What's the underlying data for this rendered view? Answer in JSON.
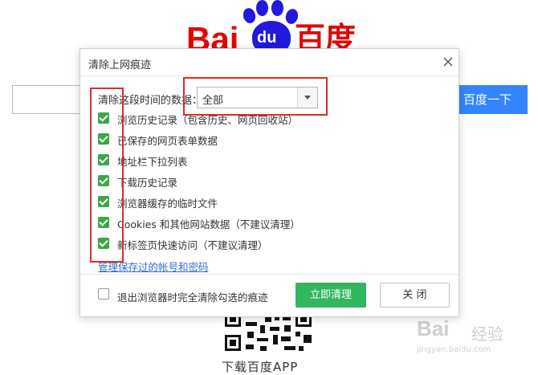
{
  "background": {
    "logo": {
      "word": "Bai",
      "du": "du",
      "cn": "百度"
    },
    "search_button": "百度一下",
    "qr_caption": "下载百度APP",
    "watermark": {
      "logo": "Bai",
      "jingyan": "经验",
      "url": "jingyan.baidu.com"
    }
  },
  "dialog": {
    "title": "清除上网痕迹",
    "range_label": "清除这段时间的数据：",
    "range_value": "全部",
    "options": [
      {
        "label": "浏览历史记录（包含历史、网页回收站）",
        "checked": true
      },
      {
        "label": "已保存的网页表单数据",
        "checked": true
      },
      {
        "label": "地址栏下拉列表",
        "checked": true
      },
      {
        "label": "下载历史记录",
        "checked": true
      },
      {
        "label": "浏览器缓存的临时文件",
        "checked": true
      },
      {
        "label": "Cookies 和其他网站数据（不建议清理）",
        "checked": true
      },
      {
        "label": "新标签页快速访问（不建议清理）",
        "checked": true
      }
    ],
    "manage_link": "管理保存过的帐号和密码",
    "exit_clear_label": "退出浏览器时完全清除勾选的痕迹",
    "exit_clear_checked": false,
    "clear_button": "立即清理",
    "close_button": "关 闭"
  },
  "colors": {
    "annotation": "#e02a2a",
    "checkbox_green": "#3aa845",
    "primary_button": "#32b65e",
    "link": "#2d6fd8",
    "search_blue": "#3385ff",
    "baidu_red": "#e10601",
    "baidu_blue": "#2319dc"
  }
}
